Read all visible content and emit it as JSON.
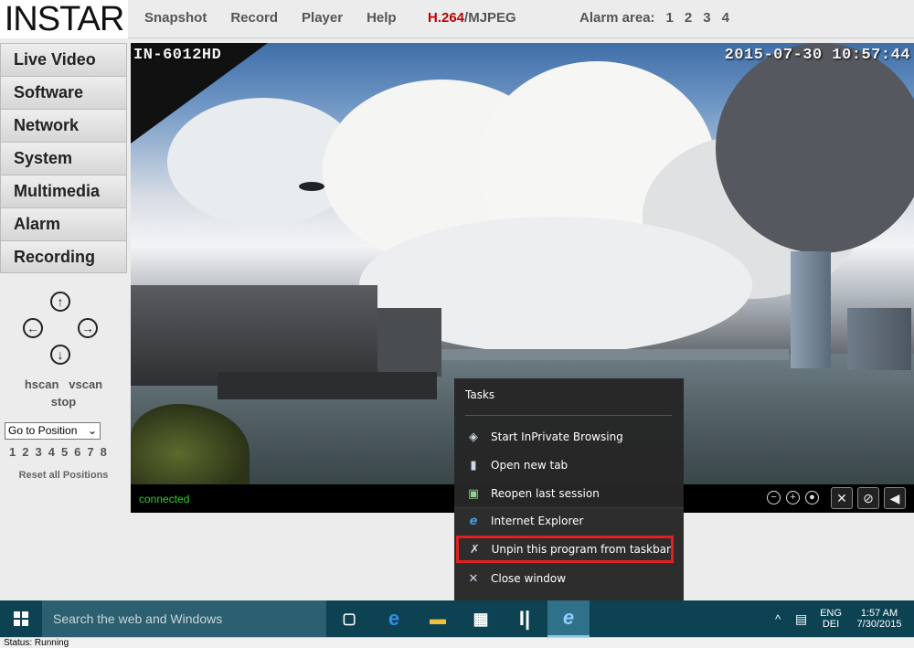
{
  "logo": {
    "text": "INSTAR"
  },
  "top_nav": [
    "Snapshot",
    "Record",
    "Player",
    "Help"
  ],
  "codec": {
    "h264": "H.264",
    "mjpeg": "/MJPEG"
  },
  "alarm": {
    "label": "Alarm area:",
    "areas": [
      "1",
      "2",
      "3",
      "4"
    ]
  },
  "sidebar": {
    "items": [
      "Live Video",
      "Software",
      "Network",
      "System",
      "Multimedia",
      "Alarm",
      "Recording"
    ]
  },
  "ptz": {
    "hscan": "hscan",
    "vscan": "vscan",
    "stop": "stop",
    "goto_position": "Go to Position",
    "positions": [
      "1",
      "2",
      "3",
      "4",
      "5",
      "6",
      "7",
      "8"
    ],
    "reset": "Reset all Positions"
  },
  "video": {
    "camera_name": "IN-6012HD",
    "timestamp": "2015-07-30 10:57:44",
    "connection_status": "connected"
  },
  "jump_list": {
    "header": "Tasks",
    "tasks": [
      {
        "label": "Start InPrivate Browsing",
        "icon": "inprivate-icon"
      },
      {
        "label": "Open new tab",
        "icon": "new-tab-icon"
      },
      {
        "label": "Reopen last session",
        "icon": "reopen-session-icon"
      }
    ],
    "app": {
      "label": "Internet Explorer",
      "icon": "internet-explorer-icon"
    },
    "unpin": {
      "label": "Unpin this program from taskbar",
      "icon": "unpin-icon"
    },
    "close": {
      "label": "Close window",
      "icon": "close-icon"
    },
    "highlight_color": "#e02020"
  },
  "taskbar": {
    "search_placeholder": "Search the web and Windows",
    "language_top": "ENG",
    "language_bottom": "DEI",
    "time": "1:57 AM",
    "date": "7/30/2015"
  },
  "status_bar": {
    "text": "Status: Running"
  }
}
